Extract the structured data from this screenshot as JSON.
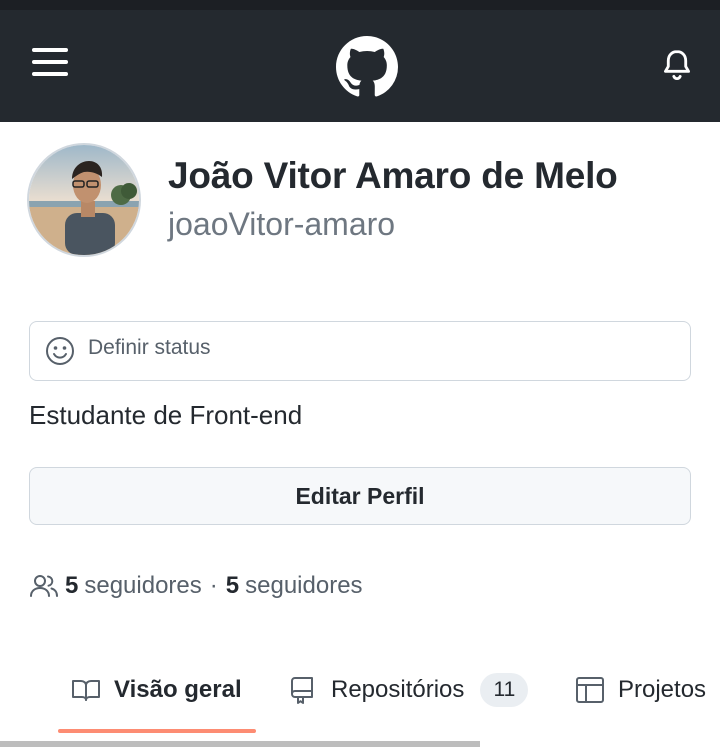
{
  "header": {
    "menu_icon": "hamburger-menu-icon",
    "logo_icon": "github-mark-icon",
    "notifications_icon": "bell-icon",
    "background_color": "#24292f"
  },
  "profile": {
    "name": "João Vitor Amaro de Melo",
    "login": "joaoVitor-amaro",
    "bio": "Estudante de Front-end"
  },
  "status": {
    "icon": "smiley-icon",
    "placeholder": "Definir status"
  },
  "edit_profile_label": "Editar Perfil",
  "followers": {
    "icon": "people-icon",
    "followers_count": "5",
    "followers_label": "seguidores",
    "separator": "·",
    "following_count": "5",
    "following_label": "seguidores"
  },
  "tabs": [
    {
      "label": "Visão geral",
      "icon": "book-icon",
      "selected": true
    },
    {
      "label": "Repositórios",
      "icon": "repo-icon",
      "counter": "11"
    },
    {
      "label": "Projetos",
      "icon": "table-icon"
    }
  ],
  "colors": {
    "accent_underline": "#fd8c73",
    "muted_text": "#6e7781"
  }
}
